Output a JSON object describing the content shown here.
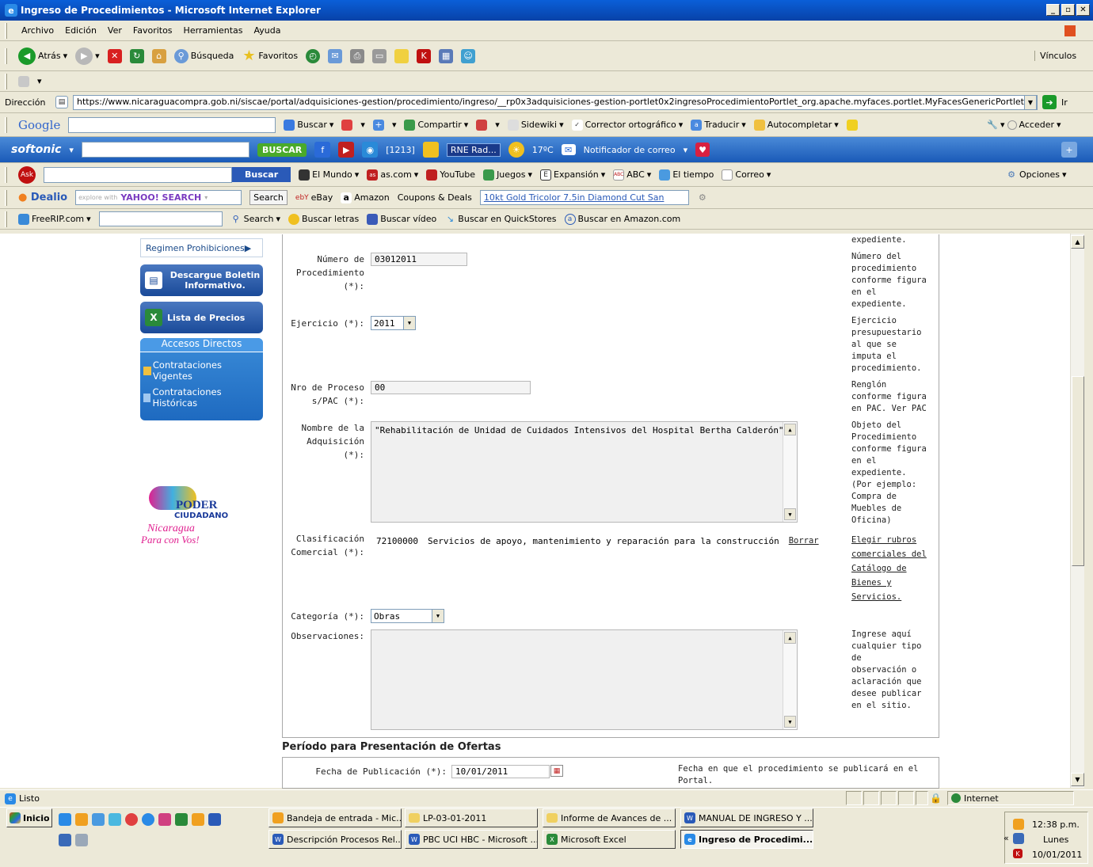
{
  "window": {
    "title": "Ingreso de Procedimientos - Microsoft Internet Explorer"
  },
  "menu": [
    "Archivo",
    "Edición",
    "Ver",
    "Favoritos",
    "Herramientas",
    "Ayuda"
  ],
  "nav": {
    "back": "Atrás",
    "search": "Búsqueda",
    "favorites": "Favoritos",
    "links": "Vínculos"
  },
  "address": {
    "label": "Dirección",
    "url": "https://www.nicaraguacompra.gob.ni/siscae/portal/adquisiciones-gestion/procedimiento/ingreso/__rp0x3adquisiciones-gestion-portlet0x2ingresoProcedimientoPortlet_org.apache.myfaces.portlet.MyFacesGenericPortlet.VIEW_ID/0x3f",
    "go": "Ir"
  },
  "google": {
    "logo": "Google",
    "buscar": "Buscar",
    "compartir": "Compartir",
    "sidewiki": "Sidewiki",
    "corrector": "Corrector ortográfico",
    "traducir": "Traducir",
    "autocompletar": "Autocompletar",
    "acceder": "Acceder"
  },
  "softonic": {
    "logo": "softonic",
    "buscar": "BUSCAR",
    "count": "[1213]",
    "radio": "RNE Rad...",
    "temp": "17ºC",
    "mail": "Notificador de correo"
  },
  "ask": {
    "logo": "Ask",
    "buscar": "Buscar",
    "items": [
      "El Mundo",
      "as.com",
      "YouTube",
      "Juegos",
      "Expansión",
      "ABC",
      "El tiempo",
      "Correo"
    ],
    "opciones": "Opciones"
  },
  "dealio": {
    "logo": "Dealio",
    "placeholder": "explore with",
    "yahoo": "YAHOO! SEARCH",
    "search": "Search",
    "ebay": "eBay",
    "amazon": "Amazon",
    "coupons": "Coupons & Deals",
    "deal": "10kt Gold Tricolor 7.5in Diamond Cut San"
  },
  "freerip": {
    "logo": "FreeRIP.com",
    "search": "Search",
    "letras": "Buscar letras",
    "video": "Buscar vídeo",
    "quickstores": "Buscar en QuickStores",
    "amazon": "Buscar en Amazon.com"
  },
  "sidebar": {
    "regimen": "Regimen Prohibiciones",
    "descargue": "Descargue Boletin Informativo.",
    "lista": "Lista de Precios",
    "accesos": "Accesos Directos",
    "vigentes": "Contrataciones Vigentes",
    "historicas": "Contrataciones Históricas",
    "logo1": "PODER",
    "logo2": "CIUDADANO",
    "logo3": "Nicaragua",
    "logo4": "Para con Vos!"
  },
  "form": {
    "top_help": "expediente.",
    "numero": {
      "label": [
        "Número de",
        "Procedimiento",
        "(*):"
      ],
      "value": "03012011",
      "help": [
        "Número del",
        "procedimiento",
        "conforme figura",
        "en el",
        "expediente."
      ]
    },
    "ejercicio": {
      "label": "Ejercicio (*):",
      "value": "2011",
      "help": [
        "Ejercicio",
        "presupuestario",
        "al que se",
        "imputa el",
        "procedimiento."
      ]
    },
    "proceso": {
      "label": [
        "Nro de Proceso",
        "s/PAC (*):"
      ],
      "value": "00",
      "help": [
        "Renglón",
        "conforme figura",
        "en PAC. Ver PAC"
      ]
    },
    "nombre": {
      "label": [
        "Nombre de la",
        "Adquisición",
        "(*):"
      ],
      "value": "\"Rehabilitación de Unidad de Cuidados Intensivos del Hospital Bertha Calderón\"",
      "help": [
        "Objeto del",
        "Procedimiento",
        "conforme figura",
        "en el",
        "expediente.",
        "(Por ejemplo:",
        "Compra de",
        "Muebles de",
        "Oficina)"
      ]
    },
    "clasificacion": {
      "label": [
        "Clasificación",
        "Comercial (*):"
      ],
      "code": "72100000",
      "desc": "Servicios de apoyo, mantenimiento y reparación para la construcción",
      "borrar": "Borrar",
      "help": [
        "Elegir rubros",
        "comerciales del",
        "Catálogo de",
        "Bienes y",
        "Servicios."
      ]
    },
    "categoria": {
      "label": "Categoría (*):",
      "value": "Obras"
    },
    "observaciones": {
      "label": "Observaciones:",
      "help": [
        "Ingrese aquí",
        "cualquier tipo de",
        "observación o",
        "aclaración que",
        "desee publicar",
        "en el sitio."
      ]
    }
  },
  "periodo": {
    "title": "Período para Presentación de Ofertas",
    "fecha_label": "Fecha de Publicación (*):",
    "fecha_value": "10/01/2011",
    "fecha_help": [
      "Fecha en que el procedimiento se publicará en el",
      "Portal."
    ]
  },
  "status": {
    "text": "Listo",
    "zone": "Internet"
  },
  "taskbar": {
    "start": "Inicio",
    "buttons": [
      "Bandeja de entrada - Mic...",
      "LP-03-01-2011",
      "Informe de Avances de ...",
      "MANUAL DE INGRESO Y ...",
      "Descripción Procesos Rel...",
      "PBC UCI HBC - Microsoft ...",
      "Microsoft Excel",
      "Ingreso de Procedimi..."
    ],
    "time": "12:38 p.m.",
    "day": "Lunes",
    "date": "10/01/2011"
  }
}
